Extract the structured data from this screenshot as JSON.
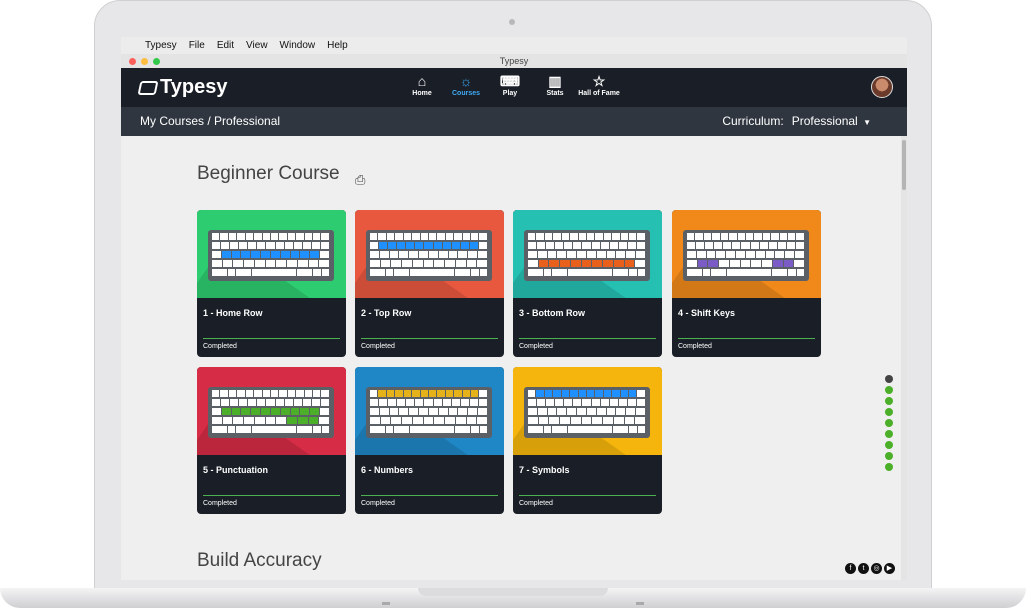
{
  "menubar": {
    "app": "Typesy",
    "items": [
      "File",
      "Edit",
      "View",
      "Window",
      "Help"
    ]
  },
  "window_title": "Typesy",
  "colors": {
    "close": "#fc605b",
    "minimize": "#fdbc40",
    "zoom": "#34c84a",
    "accent": "#3fa9f5",
    "progress": "#4caf50"
  },
  "nav": {
    "logo": "Typesy",
    "items": [
      {
        "label": "Home",
        "icon": "home-icon",
        "glyph": "⌂"
      },
      {
        "label": "Courses",
        "icon": "lightbulb-icon",
        "glyph": "☼"
      },
      {
        "label": "Play",
        "icon": "keyboard-icon",
        "glyph": "⌨"
      },
      {
        "label": "Stats",
        "icon": "chart-icon",
        "glyph": "▥"
      },
      {
        "label": "Hall of Fame",
        "icon": "star-icon",
        "glyph": "☆"
      }
    ],
    "active": "Courses"
  },
  "subbar": {
    "breadcrumb": "My Courses / Professional",
    "curriculum_label": "Curriculum:",
    "curriculum_value": "Professional"
  },
  "sections": [
    {
      "title": "Beginner Course"
    },
    {
      "title": "Build Accuracy"
    }
  ],
  "courses": [
    {
      "title": "1 - Home Row",
      "status": "Completed",
      "color": "#2ecc71",
      "highlight": "#1e90ff",
      "row": 2
    },
    {
      "title": "2 - Top Row",
      "status": "Completed",
      "color": "#e8583f",
      "highlight": "#1e90ff",
      "row": 1
    },
    {
      "title": "3 - Bottom Row",
      "status": "Completed",
      "color": "#26c0b3",
      "highlight": "#e8601c",
      "row": 3
    },
    {
      "title": "4 - Shift Keys",
      "status": "Completed",
      "color": "#f0891a",
      "highlight": "#7b5cc7",
      "row": 3
    },
    {
      "title": "5 - Punctuation",
      "status": "Completed",
      "color": "#d72c45",
      "highlight": "#4caf2a",
      "row": 2
    },
    {
      "title": "6 - Numbers",
      "status": "Completed",
      "color": "#1f87c5",
      "highlight": "#e6b21a",
      "row": 0
    },
    {
      "title": "7 - Symbols",
      "status": "Completed",
      "color": "#f5b50c",
      "highlight": "#1e90ff",
      "row": 0
    }
  ],
  "social": [
    "f",
    "t",
    "◎",
    "▶"
  ]
}
